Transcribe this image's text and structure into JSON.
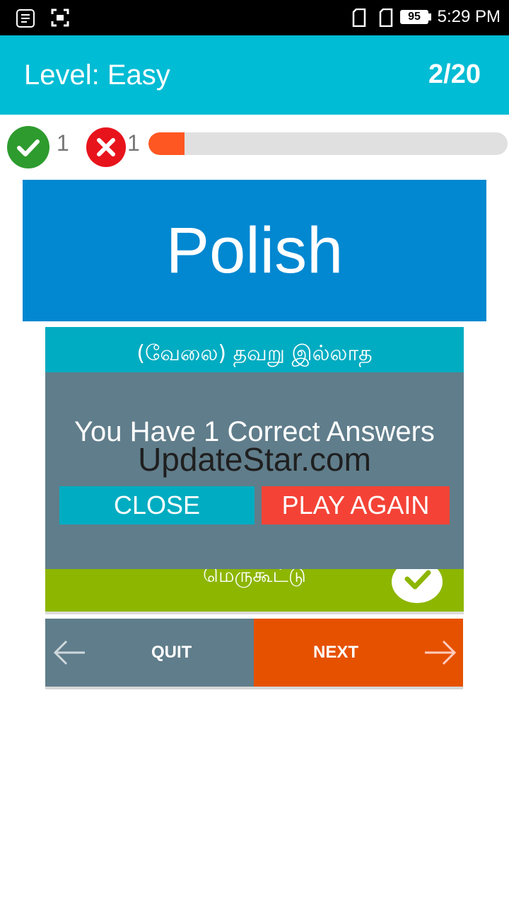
{
  "status_bar": {
    "time": "5:29 PM",
    "battery": "95",
    "icons": [
      "list-icon",
      "screenshot-icon",
      "sim-card-icon",
      "sim-card-icon",
      "battery-icon"
    ]
  },
  "header": {
    "level_label": "Level: Easy",
    "counter": "2/20"
  },
  "score": {
    "correct_count": "1",
    "wrong_count": "1",
    "progress_fraction": 0.1,
    "icons": [
      "check-circle-icon",
      "x-circle-icon"
    ]
  },
  "question": {
    "word": "Polish"
  },
  "options": [
    {
      "text": "(வேலை) தவறு இல்லாத"
    },
    {
      "text": "மெருகூட்டு",
      "state": "correct",
      "icon": "check-icon"
    }
  ],
  "dialog": {
    "message": "You Have 1 Correct Answers",
    "watermark": "UpdateStar.com",
    "close_label": "CLOSE",
    "play_again_label": "PLAY AGAIN"
  },
  "nav": {
    "quit_label": "QUIT",
    "next_label": "NEXT",
    "icons": [
      "arrow-left-icon",
      "arrow-right-icon"
    ]
  },
  "colors": {
    "app_bar": "#00bcd4",
    "word_card": "#0288d1",
    "correct": "#2e9b2e",
    "wrong": "#e8141c",
    "progress": "#ff5722",
    "dialog": "#607d8b",
    "play_again": "#f44336",
    "next": "#e65100",
    "correct_option": "#8db600"
  }
}
